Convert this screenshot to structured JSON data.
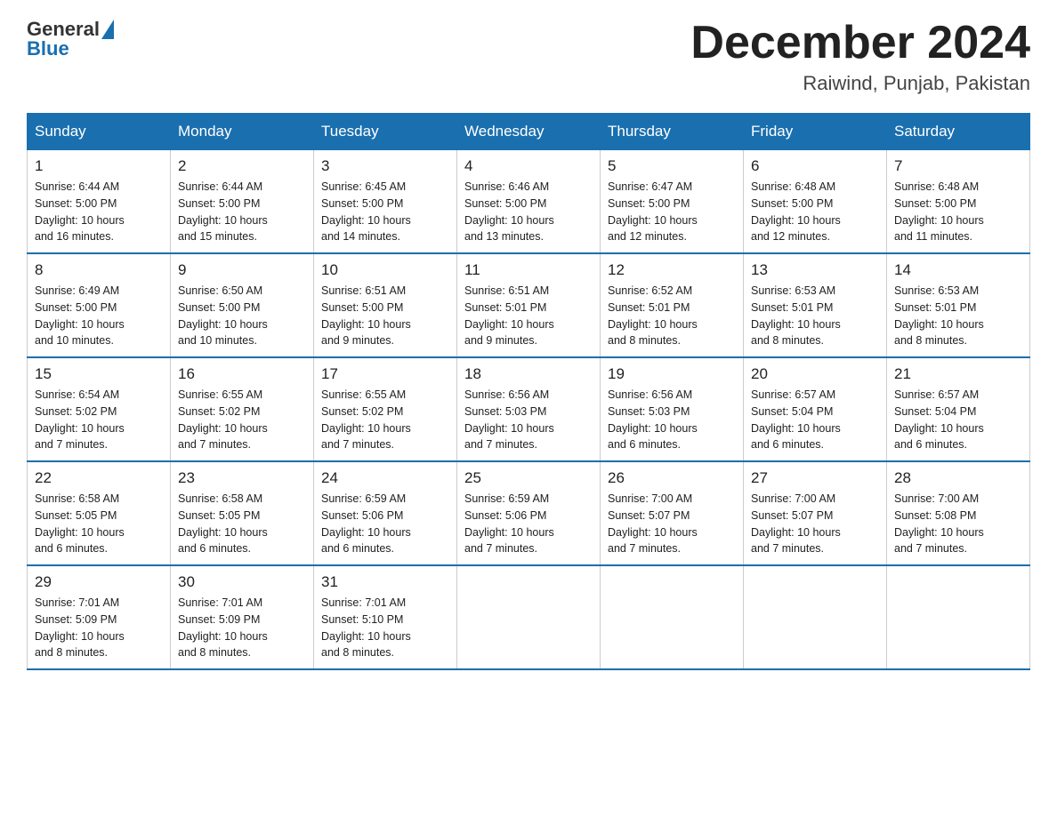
{
  "logo": {
    "text_general": "General",
    "text_blue": "Blue"
  },
  "header": {
    "month": "December 2024",
    "location": "Raiwind, Punjab, Pakistan"
  },
  "weekdays": [
    "Sunday",
    "Monday",
    "Tuesday",
    "Wednesday",
    "Thursday",
    "Friday",
    "Saturday"
  ],
  "weeks": [
    [
      {
        "day": 1,
        "sunrise": "6:44 AM",
        "sunset": "5:00 PM",
        "daylight": "10 hours and 16 minutes."
      },
      {
        "day": 2,
        "sunrise": "6:44 AM",
        "sunset": "5:00 PM",
        "daylight": "10 hours and 15 minutes."
      },
      {
        "day": 3,
        "sunrise": "6:45 AM",
        "sunset": "5:00 PM",
        "daylight": "10 hours and 14 minutes."
      },
      {
        "day": 4,
        "sunrise": "6:46 AM",
        "sunset": "5:00 PM",
        "daylight": "10 hours and 13 minutes."
      },
      {
        "day": 5,
        "sunrise": "6:47 AM",
        "sunset": "5:00 PM",
        "daylight": "10 hours and 12 minutes."
      },
      {
        "day": 6,
        "sunrise": "6:48 AM",
        "sunset": "5:00 PM",
        "daylight": "10 hours and 12 minutes."
      },
      {
        "day": 7,
        "sunrise": "6:48 AM",
        "sunset": "5:00 PM",
        "daylight": "10 hours and 11 minutes."
      }
    ],
    [
      {
        "day": 8,
        "sunrise": "6:49 AM",
        "sunset": "5:00 PM",
        "daylight": "10 hours and 10 minutes."
      },
      {
        "day": 9,
        "sunrise": "6:50 AM",
        "sunset": "5:00 PM",
        "daylight": "10 hours and 10 minutes."
      },
      {
        "day": 10,
        "sunrise": "6:51 AM",
        "sunset": "5:00 PM",
        "daylight": "10 hours and 9 minutes."
      },
      {
        "day": 11,
        "sunrise": "6:51 AM",
        "sunset": "5:01 PM",
        "daylight": "10 hours and 9 minutes."
      },
      {
        "day": 12,
        "sunrise": "6:52 AM",
        "sunset": "5:01 PM",
        "daylight": "10 hours and 8 minutes."
      },
      {
        "day": 13,
        "sunrise": "6:53 AM",
        "sunset": "5:01 PM",
        "daylight": "10 hours and 8 minutes."
      },
      {
        "day": 14,
        "sunrise": "6:53 AM",
        "sunset": "5:01 PM",
        "daylight": "10 hours and 8 minutes."
      }
    ],
    [
      {
        "day": 15,
        "sunrise": "6:54 AM",
        "sunset": "5:02 PM",
        "daylight": "10 hours and 7 minutes."
      },
      {
        "day": 16,
        "sunrise": "6:55 AM",
        "sunset": "5:02 PM",
        "daylight": "10 hours and 7 minutes."
      },
      {
        "day": 17,
        "sunrise": "6:55 AM",
        "sunset": "5:02 PM",
        "daylight": "10 hours and 7 minutes."
      },
      {
        "day": 18,
        "sunrise": "6:56 AM",
        "sunset": "5:03 PM",
        "daylight": "10 hours and 7 minutes."
      },
      {
        "day": 19,
        "sunrise": "6:56 AM",
        "sunset": "5:03 PM",
        "daylight": "10 hours and 6 minutes."
      },
      {
        "day": 20,
        "sunrise": "6:57 AM",
        "sunset": "5:04 PM",
        "daylight": "10 hours and 6 minutes."
      },
      {
        "day": 21,
        "sunrise": "6:57 AM",
        "sunset": "5:04 PM",
        "daylight": "10 hours and 6 minutes."
      }
    ],
    [
      {
        "day": 22,
        "sunrise": "6:58 AM",
        "sunset": "5:05 PM",
        "daylight": "10 hours and 6 minutes."
      },
      {
        "day": 23,
        "sunrise": "6:58 AM",
        "sunset": "5:05 PM",
        "daylight": "10 hours and 6 minutes."
      },
      {
        "day": 24,
        "sunrise": "6:59 AM",
        "sunset": "5:06 PM",
        "daylight": "10 hours and 6 minutes."
      },
      {
        "day": 25,
        "sunrise": "6:59 AM",
        "sunset": "5:06 PM",
        "daylight": "10 hours and 7 minutes."
      },
      {
        "day": 26,
        "sunrise": "7:00 AM",
        "sunset": "5:07 PM",
        "daylight": "10 hours and 7 minutes."
      },
      {
        "day": 27,
        "sunrise": "7:00 AM",
        "sunset": "5:07 PM",
        "daylight": "10 hours and 7 minutes."
      },
      {
        "day": 28,
        "sunrise": "7:00 AM",
        "sunset": "5:08 PM",
        "daylight": "10 hours and 7 minutes."
      }
    ],
    [
      {
        "day": 29,
        "sunrise": "7:01 AM",
        "sunset": "5:09 PM",
        "daylight": "10 hours and 8 minutes."
      },
      {
        "day": 30,
        "sunrise": "7:01 AM",
        "sunset": "5:09 PM",
        "daylight": "10 hours and 8 minutes."
      },
      {
        "day": 31,
        "sunrise": "7:01 AM",
        "sunset": "5:10 PM",
        "daylight": "10 hours and 8 minutes."
      },
      null,
      null,
      null,
      null
    ]
  ],
  "labels": {
    "sunrise": "Sunrise:",
    "sunset": "Sunset:",
    "daylight": "Daylight:"
  }
}
